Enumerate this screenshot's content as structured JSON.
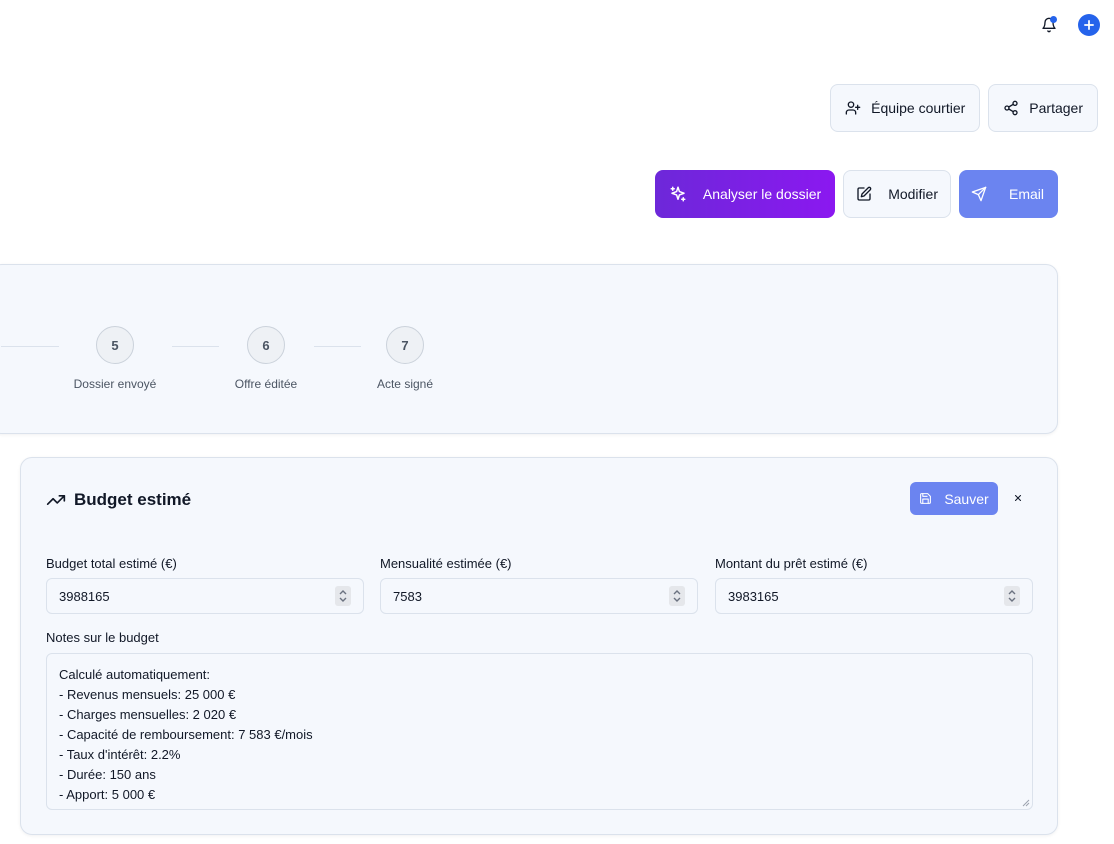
{
  "topbar": {
    "icons": [
      "bell-icon",
      "plus-icon"
    ]
  },
  "header_actions": {
    "team_label": "Équipe courtier",
    "share_label": "Partager"
  },
  "actions": {
    "analyze_label": "Analyser le dossier",
    "edit_label": "Modifier",
    "email_label": "Email"
  },
  "stepper": {
    "steps": [
      {
        "number": "5",
        "label": "Dossier envoyé"
      },
      {
        "number": "6",
        "label": "Offre éditée"
      },
      {
        "number": "7",
        "label": "Acte signé"
      }
    ]
  },
  "budget": {
    "title": "Budget estimé",
    "save_label": "Sauver",
    "fields": {
      "total": {
        "label": "Budget total estimé (€)",
        "value": "3988165"
      },
      "monthly": {
        "label": "Mensualité estimée (€)",
        "value": "7583"
      },
      "loan": {
        "label": "Montant du prêt estimé (€)",
        "value": "3983165"
      }
    },
    "notes_label": "Notes sur le budget",
    "notes_lines": [
      "Calculé automatiquement:",
      "- Revenus mensuels: 25 000 €",
      "- Charges mensuelles: 2 020 €",
      "- Capacité de remboursement: 7 583 €/mois",
      "- Taux d'intérêt: 2.2%",
      "- Durée: 150 ans",
      "- Apport: 5 000 €"
    ]
  },
  "colors": {
    "accent_blue": "#2563eb",
    "primary_gradient_start": "#6d28d9",
    "primary_gradient_end": "#8b18f0",
    "button_blue": "#6b84f0",
    "card_bg": "#f5f8fd"
  }
}
